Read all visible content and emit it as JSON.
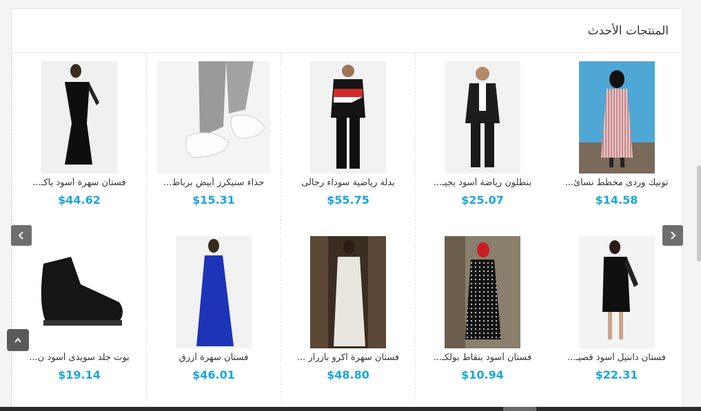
{
  "section": {
    "title": "المنتجات الأحدث"
  },
  "products": [
    {
      "name": "تونيك وردى مخطط نسائ...",
      "price": "$14.58"
    },
    {
      "name": "بنطلون رياضة أسود بجيـ...",
      "price": "$25.07"
    },
    {
      "name": "بدلة رياضية سوداء رجالى",
      "price": "$55.75"
    },
    {
      "name": "حذاء سنيكرز أبيض برباط...",
      "price": "$15.31"
    },
    {
      "name": "فستان سهرة أسود بأكـ...",
      "price": "$44.62"
    },
    {
      "name": "فستان دانتيل أسود قصيـ...",
      "price": "$22.31"
    },
    {
      "name": "فستان أسود بنقاط بولكـ...",
      "price": "$10.94"
    },
    {
      "name": "فستان سهرة اكرو بأزرار ...",
      "price": "$48.80"
    },
    {
      "name": "فستان سهرة أزرق",
      "price": "$46.01"
    },
    {
      "name": "بوت جلد سويدى أسود ن...",
      "price": "$19.14"
    }
  ],
  "colors": {
    "price": "#1aa6db",
    "nav_button": "#6e6e6e"
  },
  "icons": {
    "prev": "chevron-left-icon",
    "next": "chevron-right-icon",
    "top": "chevron-up-icon"
  }
}
